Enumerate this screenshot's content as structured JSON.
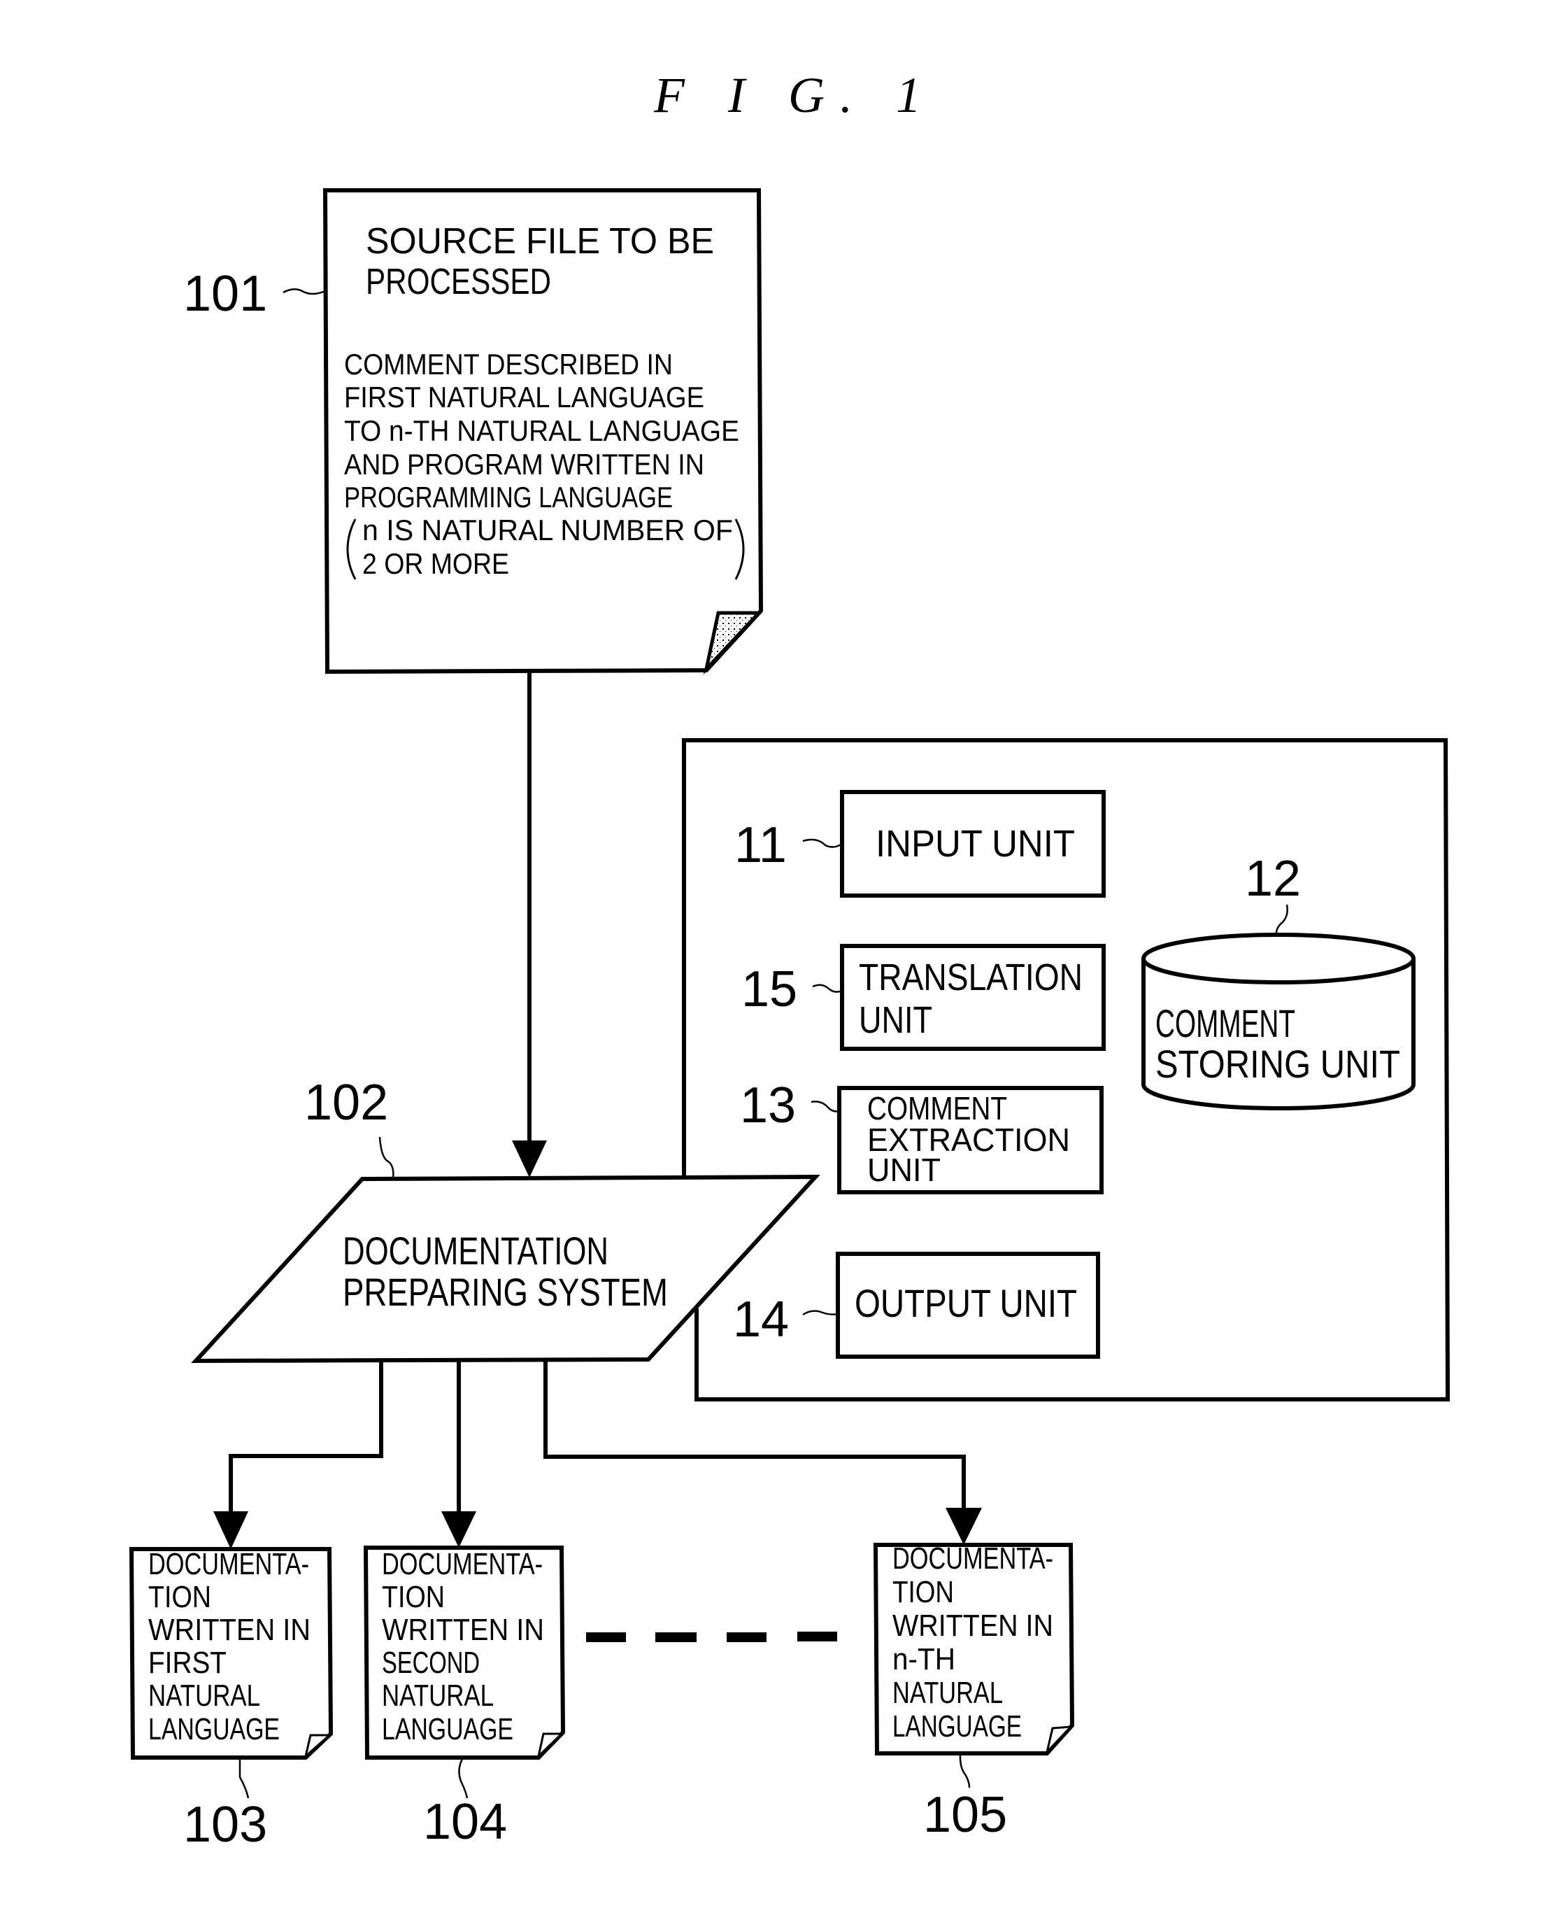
{
  "figure": {
    "title": "F I G. 1"
  },
  "source_file": {
    "ref": "101",
    "title_lines": [
      "SOURCE FILE TO BE",
      "PROCESSED"
    ],
    "body_lines": [
      "COMMENT DESCRIBED IN",
      "FIRST NATURAL LANGUAGE",
      "TO n-TH NATURAL LANGUAGE",
      "AND PROGRAM WRITTEN IN",
      "PROGRAMMING LANGUAGE",
      "n IS NATURAL NUMBER OF",
      "2 OR MORE"
    ]
  },
  "system": {
    "ref": "102",
    "lines": [
      "DOCUMENTATION",
      "PREPARING SYSTEM"
    ]
  },
  "units": [
    {
      "ref": "11",
      "lines": [
        "INPUT UNIT"
      ]
    },
    {
      "ref": "15",
      "lines": [
        "TRANSLATION",
        "UNIT"
      ]
    },
    {
      "ref": "13",
      "lines": [
        "COMMENT",
        "EXTRACTION",
        "UNIT"
      ]
    },
    {
      "ref": "14",
      "lines": [
        "OUTPUT UNIT"
      ]
    }
  ],
  "storage": {
    "ref": "12",
    "lines": [
      "COMMENT",
      "STORING UNIT"
    ]
  },
  "outputs": [
    {
      "ref": "103",
      "lines": [
        "DOCUMENTA-",
        "TION",
        "WRITTEN IN",
        "FIRST",
        "NATURAL",
        "LANGUAGE"
      ]
    },
    {
      "ref": "104",
      "lines": [
        "DOCUMENTA-",
        "TION",
        "WRITTEN IN",
        "SECOND",
        "NATURAL",
        "LANGUAGE"
      ]
    },
    {
      "ref": "105",
      "lines": [
        "DOCUMENTA-",
        "TION",
        "WRITTEN IN",
        "n-TH",
        "NATURAL",
        "LANGUAGE"
      ]
    }
  ]
}
